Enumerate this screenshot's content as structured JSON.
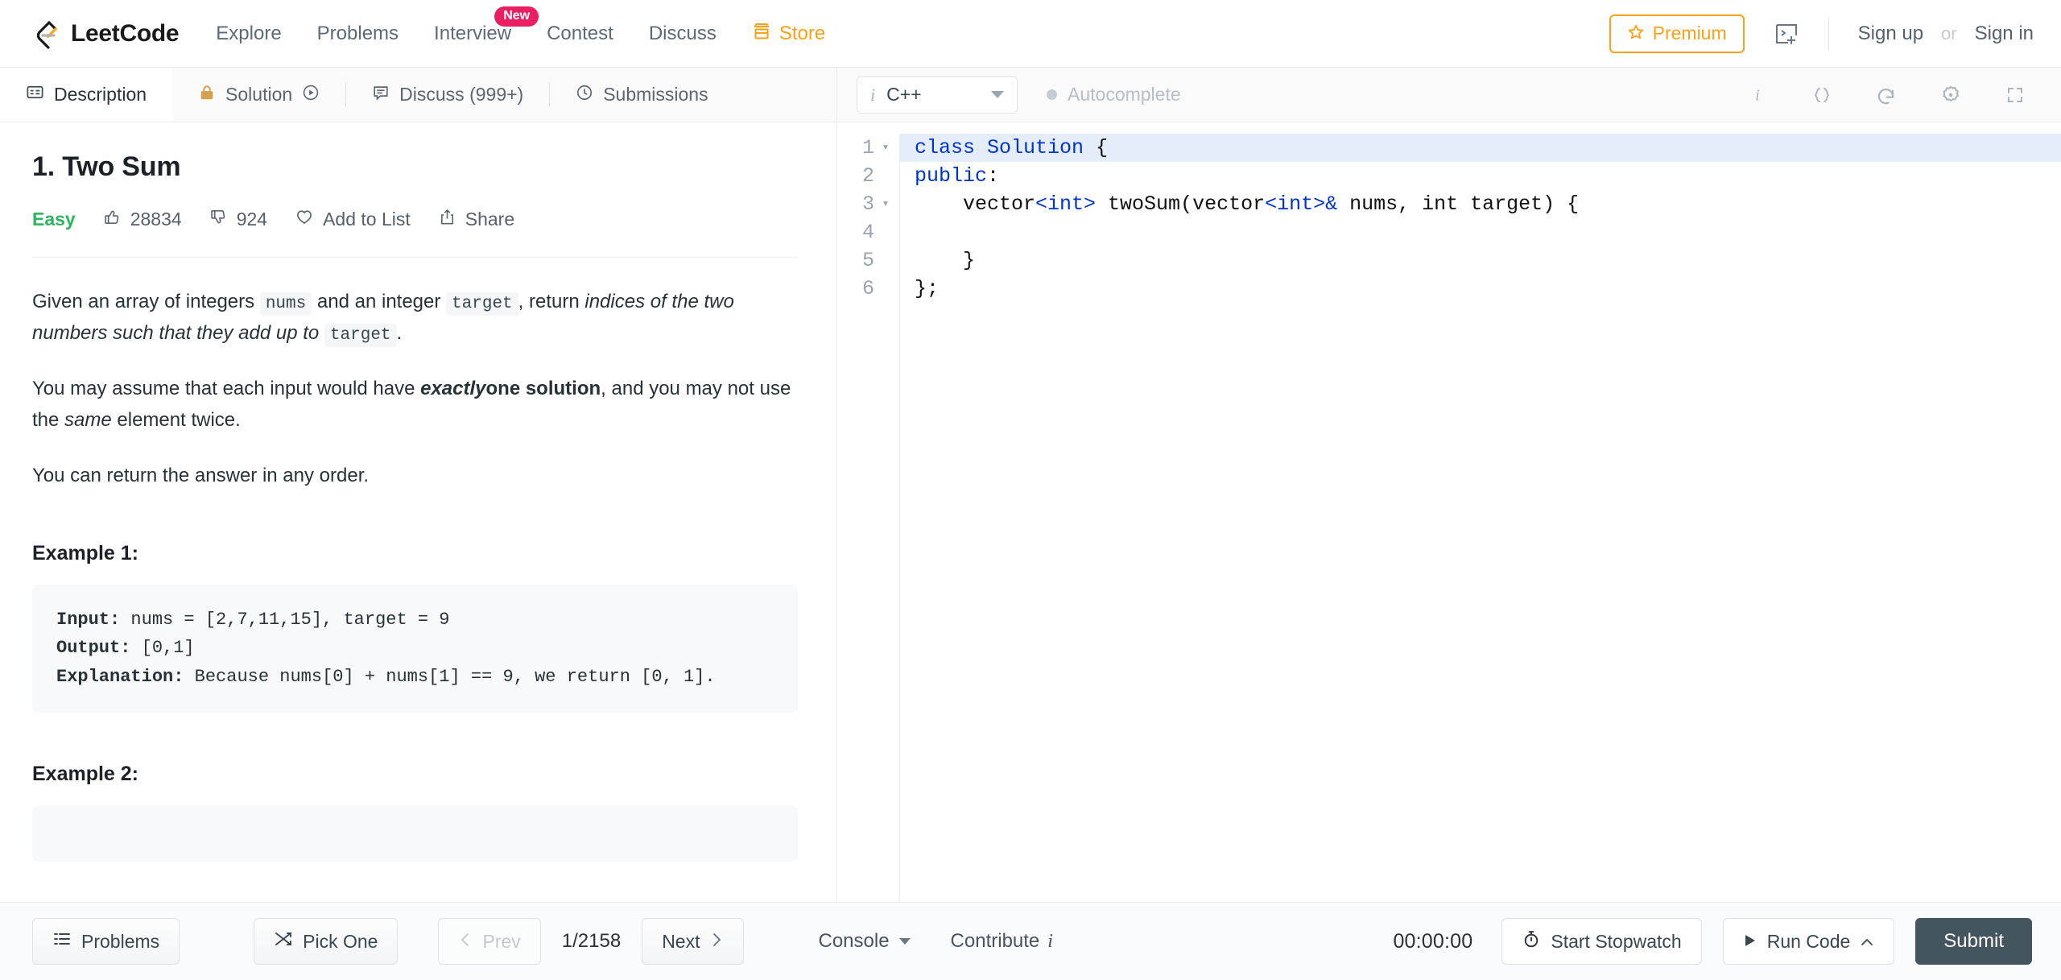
{
  "header": {
    "brand": "LeetCode",
    "nav": [
      {
        "label": "Explore",
        "badge": null
      },
      {
        "label": "Problems",
        "badge": null
      },
      {
        "label": "Interview",
        "badge": "New"
      },
      {
        "label": "Contest",
        "badge": null
      },
      {
        "label": "Discuss",
        "badge": null
      },
      {
        "label": "Store",
        "badge": null,
        "accent": "#ffa116"
      }
    ],
    "premium_label": "Premium",
    "new_file_icon": "new-playground-icon",
    "sign_up": "Sign up",
    "or": "or",
    "sign_in": "Sign in"
  },
  "tabs": {
    "description": "Description",
    "solution": "Solution",
    "discuss": "Discuss (999+)",
    "submissions": "Submissions"
  },
  "editor_bar": {
    "language": "C++",
    "autocomplete": "Autocomplete",
    "tools": [
      "info-icon",
      "format-braces-icon",
      "reset-icon",
      "settings-gear-icon",
      "fullscreen-icon"
    ]
  },
  "problem": {
    "title": "1. Two Sum",
    "difficulty": "Easy",
    "likes": "28834",
    "dislikes": "924",
    "add_to_list": "Add to List",
    "share": "Share",
    "paragraphs": [
      "Given an array of integers nums and an integer target , return indices of the two numbers such that they add up to target .",
      "You may assume that each input would have exactly one solution, and you may not use the same element twice.",
      "You can return the answer in any order."
    ],
    "p1_a": "Given an array of integers",
    "p1_code1": "nums",
    "p1_b": "and an integer",
    "p1_code2": "target",
    "p1_c": ", return",
    "p1_em1": "indices of the two numbers such that they add up to",
    "p1_code3": "target",
    "p1_d": ".",
    "p2_a": "You may assume that each input would have",
    "p2_bold_em": "exactly",
    "p2_bold": "one solution",
    "p2_b": ", and you may not use the",
    "p2_em": "same",
    "p2_c": "element twice.",
    "p3": "You can return the answer in any order.",
    "example1_head": "Example 1:",
    "example1_input_label": "Input:",
    "example1_input": " nums = [2,7,11,15], target = 9",
    "example1_output_label": "Output:",
    "example1_output": " [0,1]",
    "example1_expl_label": "Explanation:",
    "example1_expl": " Because nums[0] + nums[1] == 9, we return [0, 1].",
    "example2_head": "Example 2:"
  },
  "code": {
    "lines": [
      {
        "n": "1",
        "fold": true,
        "highlight": true
      },
      {
        "n": "2",
        "fold": false,
        "highlight": false
      },
      {
        "n": "3",
        "fold": true,
        "highlight": false
      },
      {
        "n": "4",
        "fold": false,
        "highlight": false
      },
      {
        "n": "5",
        "fold": false,
        "highlight": false
      },
      {
        "n": "6",
        "fold": false,
        "highlight": false
      }
    ],
    "text": [
      "class Solution {",
      "public:",
      "    vector<int> twoSum(vector<int>& nums, int target) {",
      "",
      "    }",
      "};"
    ]
  },
  "bottom": {
    "problems": "Problems",
    "pick_one": "Pick One",
    "prev": "Prev",
    "page": "1/2158",
    "next": "Next",
    "console": "Console",
    "contribute": "Contribute",
    "timer": "00:00:00",
    "start_stopwatch": "Start Stopwatch",
    "run_code": "Run Code",
    "submit": "Submit"
  },
  "colors": {
    "accent_orange": "#ffa116",
    "easy_green": "#2db55d",
    "badge_pink": "#e91e63",
    "submit_dark": "#455560",
    "code_blue": "#0033cc"
  }
}
